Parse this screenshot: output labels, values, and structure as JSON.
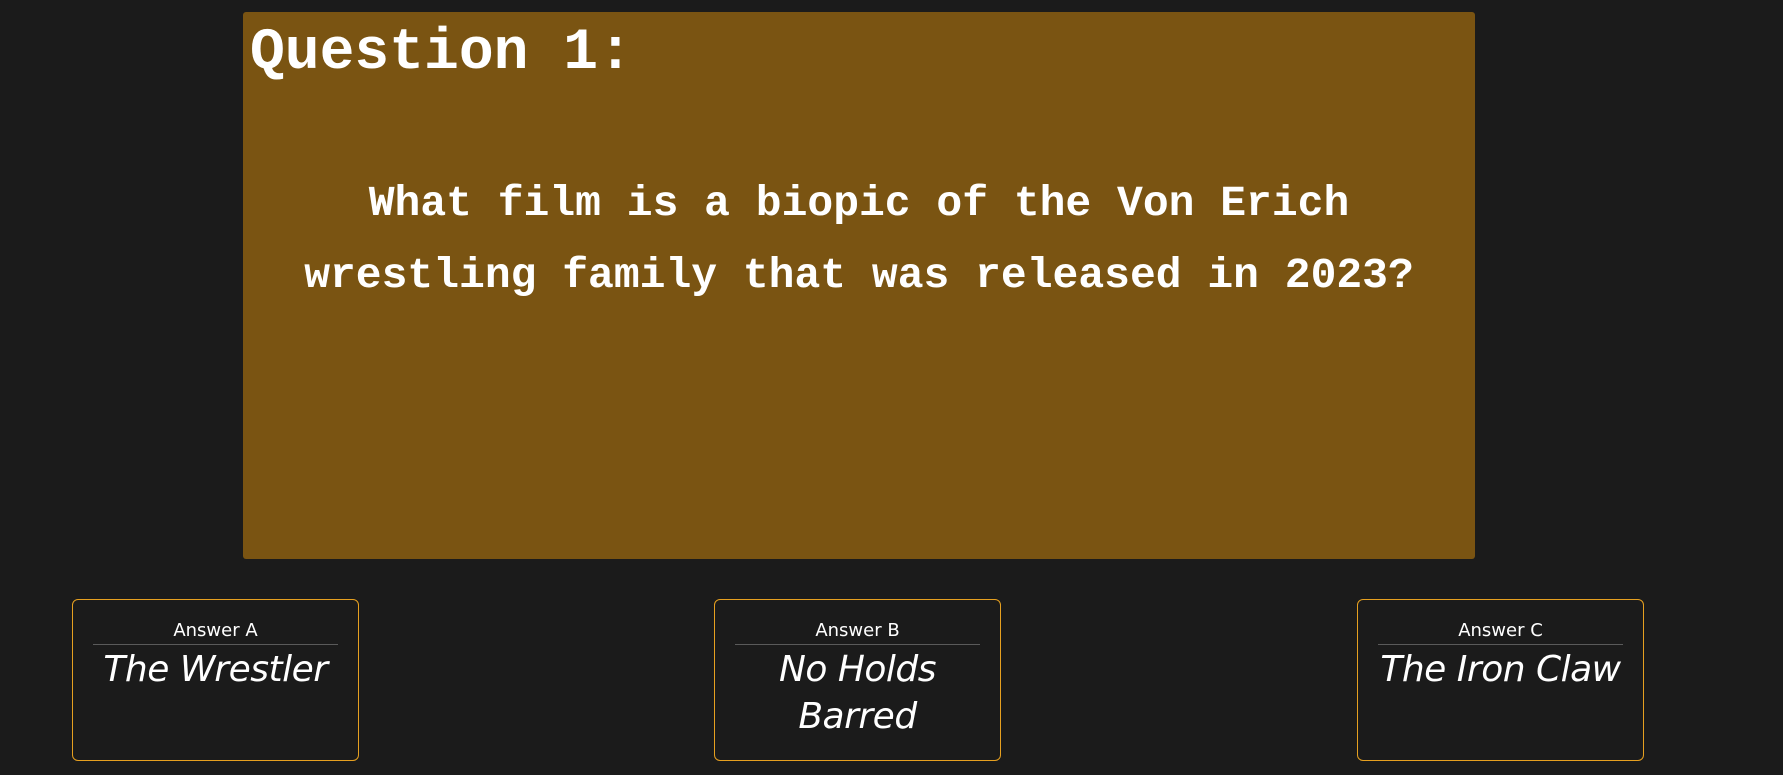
{
  "question": {
    "title": "Question 1:",
    "text": "What film is a biopic of the Von Erich wrestling family that was released in 2023?"
  },
  "answers": [
    {
      "label": "Answer A",
      "text": "The Wrestler"
    },
    {
      "label": "Answer B",
      "text": "No Holds Barred"
    },
    {
      "label": "Answer C",
      "text": "The Iron Claw"
    }
  ],
  "colors": {
    "background": "#1b1b1b",
    "question_card": "#7a5412",
    "answer_border": "#e6a020",
    "text": "#ffffff"
  }
}
